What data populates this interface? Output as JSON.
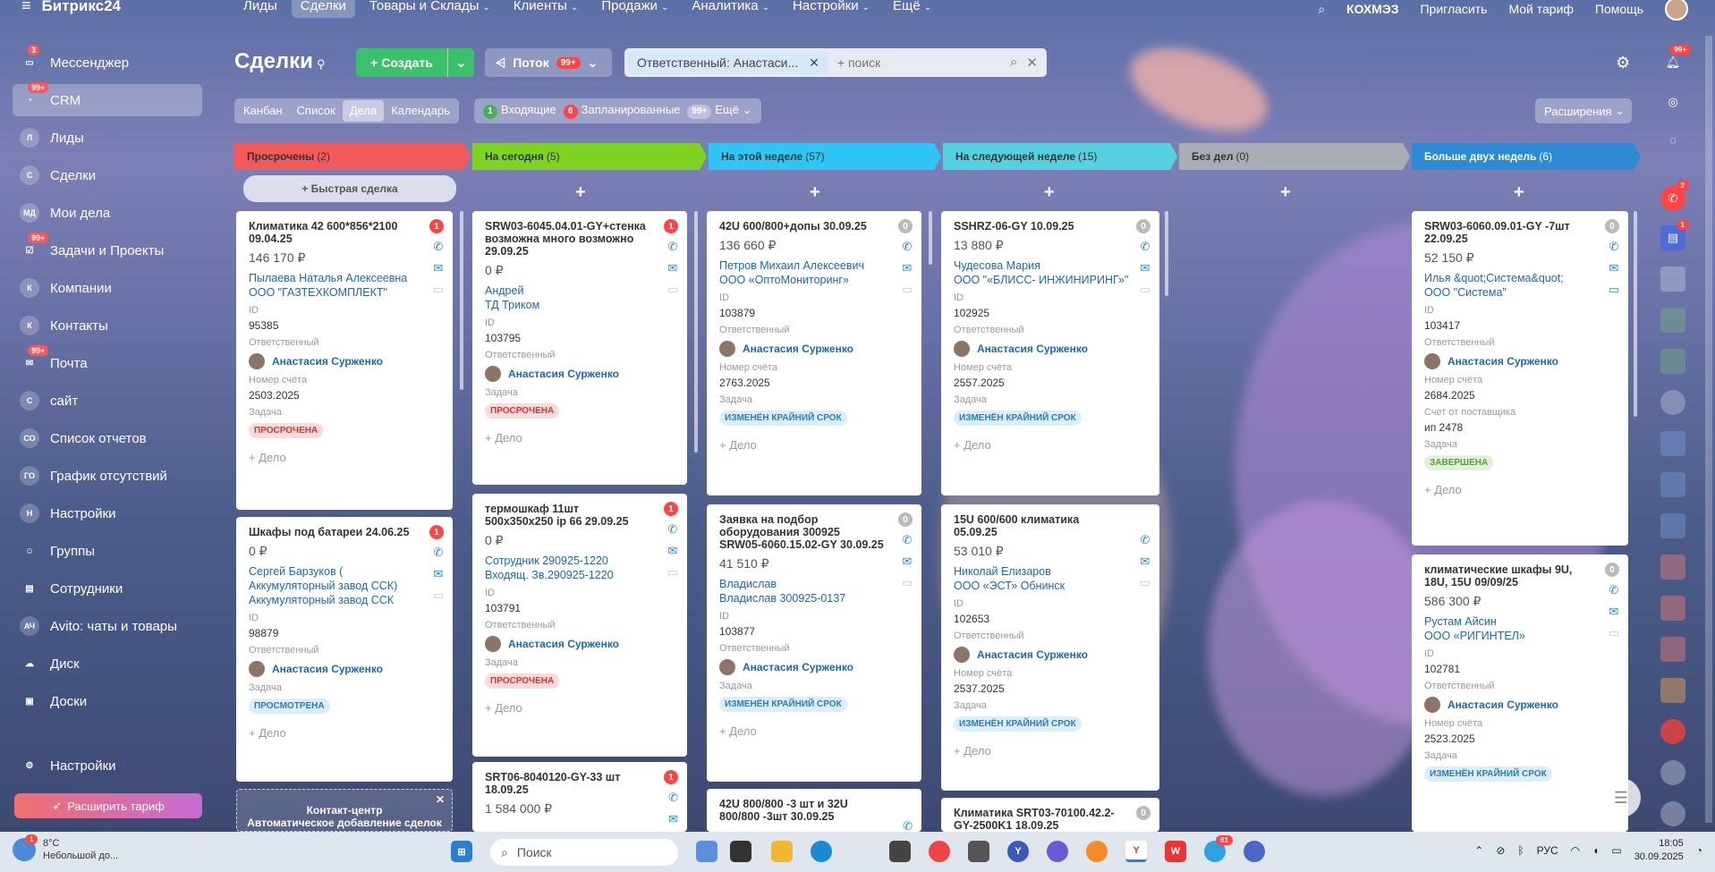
{
  "app": {
    "logo": "Битрикс24"
  },
  "topnav": {
    "items": [
      {
        "label": "Лиды",
        "active": false,
        "caret": false
      },
      {
        "label": "Сделки",
        "active": true,
        "caret": false
      },
      {
        "label": "Товары и Склады",
        "active": false,
        "caret": true
      },
      {
        "label": "Клиенты",
        "active": false,
        "caret": true
      },
      {
        "label": "Продажи",
        "active": false,
        "caret": true
      },
      {
        "label": "Аналитика",
        "active": false,
        "caret": true
      },
      {
        "label": "Настройки",
        "active": false,
        "caret": true
      },
      {
        "label": "Ещё",
        "active": false,
        "caret": true
      }
    ],
    "invite": "Пригласить",
    "mytariff": "Мой тариф",
    "help": "Помощь",
    "account": "КОХМЭЗ"
  },
  "sidebar": {
    "items": [
      {
        "label": "Мессенджер",
        "icon": "messenger-icon",
        "badge": "3"
      },
      {
        "label": "CRM",
        "icon": "crm-icon",
        "badge": "99+",
        "active": true
      },
      {
        "label": "Лиды",
        "icon": "Л"
      },
      {
        "label": "Сделки",
        "icon": "С"
      },
      {
        "label": "Мои дела",
        "icon": "МД"
      },
      {
        "label": "Задачи и Проекты",
        "icon": "tasks-icon",
        "badge": "99+"
      },
      {
        "label": "Компании",
        "icon": "К"
      },
      {
        "label": "Контакты",
        "icon": "К"
      },
      {
        "label": "Почта",
        "icon": "mail-icon",
        "badge": "99+"
      },
      {
        "label": "сайт",
        "icon": "С"
      },
      {
        "label": "Список отчетов",
        "icon": "СО"
      },
      {
        "label": "График отсутствий",
        "icon": "ГО"
      },
      {
        "label": "Настройки",
        "icon": "Н"
      },
      {
        "label": "Группы",
        "icon": "groups-icon"
      },
      {
        "label": "Сотрудники",
        "icon": "employees-icon"
      },
      {
        "label": "Avito: чаты и товары",
        "icon": "АЧ"
      },
      {
        "label": "Диск",
        "icon": "disk-icon"
      },
      {
        "label": "Доски",
        "icon": "boards-icon"
      }
    ],
    "settings": "Настройки",
    "upgrade": "Расширить тариф"
  },
  "header": {
    "title": "Сделки",
    "create": "Создать",
    "stream": "Поток",
    "stream_badge": "99+",
    "filter_chip": "Ответственный: Анастаси...",
    "search_placeholder": "+ поиск"
  },
  "views": {
    "items": [
      "Канбан",
      "Список",
      "Дела",
      "Календарь"
    ],
    "active": "Дела"
  },
  "counters": {
    "incoming_n": "1",
    "incoming": "Входящие",
    "planned_n": "6",
    "planned": "Запланированные",
    "more_n": "99+",
    "more": "Ещё",
    "extensions": "Расширения"
  },
  "columns": [
    {
      "title": "Просрочены",
      "count": "(2)",
      "color": "#f05a5a"
    },
    {
      "title": "На сегодня",
      "count": "(5)",
      "color": "#7ed321"
    },
    {
      "title": "На этой неделе",
      "count": "(57)",
      "color": "#2fc6f6"
    },
    {
      "title": "На следующей неделе",
      "count": "(15)",
      "color": "#55d0e0"
    },
    {
      "title": "Без дел",
      "count": "(0)",
      "color": "#a8adb4"
    },
    {
      "title": "Больше двух недель",
      "count": "(6)",
      "color": "#2f8ad6"
    }
  ],
  "quick_deal": "Быстрая сделка",
  "labels": {
    "id": "ID",
    "resp": "Ответственный",
    "invoice": "Номер счёта",
    "task": "Задача",
    "supplier": "Счет от поставщика",
    "add": "+ Дело"
  },
  "responsible": "Анастасия Сурженко",
  "cards": {
    "c0_0": {
      "title": "Климатика 42 600*856*2100 09.04.25",
      "sum": "146 170 ₽",
      "client1": "Пылаева Наталья Алексеевна",
      "client2": "ООО \"ГАЗТЕХКОМПЛЕКТ\"",
      "id": "95385",
      "invoice": "2503.2025",
      "tag": "ПРОСРОЧЕНА",
      "badge": "1"
    },
    "c0_1": {
      "title": "Шкафы под батареи 24.06.25",
      "sum": "0 ₽",
      "client1": "Сергей Барзуков (",
      "client2": "Аккумуляторный завод ССК)",
      "client3": "Аккумуляторный завод ССК",
      "id": "98879",
      "tag": "ПРОСМОТРЕНА",
      "badge": "1"
    },
    "c1_0": {
      "title": "SRW03-6045.04.01-GY+стенка возможна много возможно 29.09.25",
      "sum": "0 ₽",
      "client1": "Андрей",
      "client2": "ТД Триком",
      "id": "103795",
      "tag": "ПРОСРОЧЕНА",
      "badge": "1"
    },
    "c1_1": {
      "title": "термошкаф 11шт 500х350х250 ip 66 29.09.25",
      "sum": "0 ₽",
      "client1": "Сотрудник 290925-1220",
      "client2": "Входящ. Зв.290925-1220",
      "id": "103791",
      "tag": "ПРОСРОЧЕНА",
      "badge": "1"
    },
    "c1_2": {
      "title": "SRT06-8040120-GY-33 шт 18.09.25",
      "sum": "1 584 000 ₽",
      "badge": "1"
    },
    "c2_0": {
      "title": "42U 600/800+допы 30.09.25",
      "sum": "136 660 ₽",
      "client1": "Петров Михаил Алексеевич",
      "client2": "ООО «ОптоМониторинг»",
      "id": "103879",
      "invoice": "2763.2025",
      "tag": "ИЗМЕНЁН КРАЙНИЙ СРОК",
      "badge": "0"
    },
    "c2_1": {
      "title": "Заявка на подбор оборудования 300925 SRW05-6060.15.02-GY 30.09.25",
      "sum": "41 510 ₽",
      "client1": "Владислав",
      "client2": "Владислав 300925-0137",
      "id": "103877",
      "tag": "ИЗМЕНЁН КРАЙНИЙ СРОК",
      "badge": "0"
    },
    "c2_2": {
      "title": "42U 800/800 -3 шт и 32U 800/800 -3шт 30.09.25"
    },
    "c3_0": {
      "title": "SSHRZ-06-GY 10.09.25",
      "sum": "13 880 ₽",
      "client1": "Чудесова Мария",
      "client2": "ООО \"«БЛИСС- ИНЖИНИРИНГ»\"",
      "id": "102925",
      "invoice": "2557.2025",
      "tag": "ИЗМЕНЁН КРАЙНИЙ СРОК",
      "badge": "0"
    },
    "c3_1": {
      "title": "15U 600/600 климатика 05.09.25",
      "sum": "53 010 ₽",
      "client1": "Николай Елизаров",
      "client2": "ООО «ЭСТ» Обнинск",
      "id": "102653",
      "invoice": "2537.2025",
      "tag": "ИЗМЕНЁН КРАЙНИЙ СРОК"
    },
    "c3_2": {
      "title": "Климатика SRT03-70100.42.2-GY-2500K1 18.09.25",
      "badge": "0"
    },
    "c5_0": {
      "title": "SRW03-6060.09.01-GY -7шт 22.09.25",
      "sum": "52 150 ₽",
      "client1": "Илья &quot;Система&quot;",
      "client2": "ООО \"Система\"",
      "id": "103417",
      "invoice": "2684.2025",
      "supplier": "ип 2478",
      "tag": "ЗАВЕРШЕНА",
      "badge": "0"
    },
    "c5_1": {
      "title": "климатические шкафы 9U, 18U, 15U 09/09/25",
      "sum": "586 300 ₽",
      "client1": "Рустам Айсин",
      "client2": "ООО «РИГИНТЕЛ»",
      "id": "102781",
      "invoice": "2523.2025",
      "tag": "ИЗМЕНЁН КРАЙНИЙ СРОК",
      "badge": "0"
    }
  },
  "contact_center": {
    "line1": "Контакт-центр",
    "line2": "Автоматическое добавление сделок"
  },
  "taskbar": {
    "temp": "8°C",
    "weather": "Небольшой до...",
    "weather_badge": "1",
    "search": "Поиск",
    "lang": "РУС",
    "time": "18:05",
    "date": "30.09.2025",
    "tg_badge": "61"
  },
  "rail": {
    "badge_top": "99+",
    "badge_phone": "2",
    "badge_msg": "1"
  },
  "colors": {
    "accent": "#3bc16b",
    "link": "#2067b0",
    "overdue": "#f05a5a"
  }
}
